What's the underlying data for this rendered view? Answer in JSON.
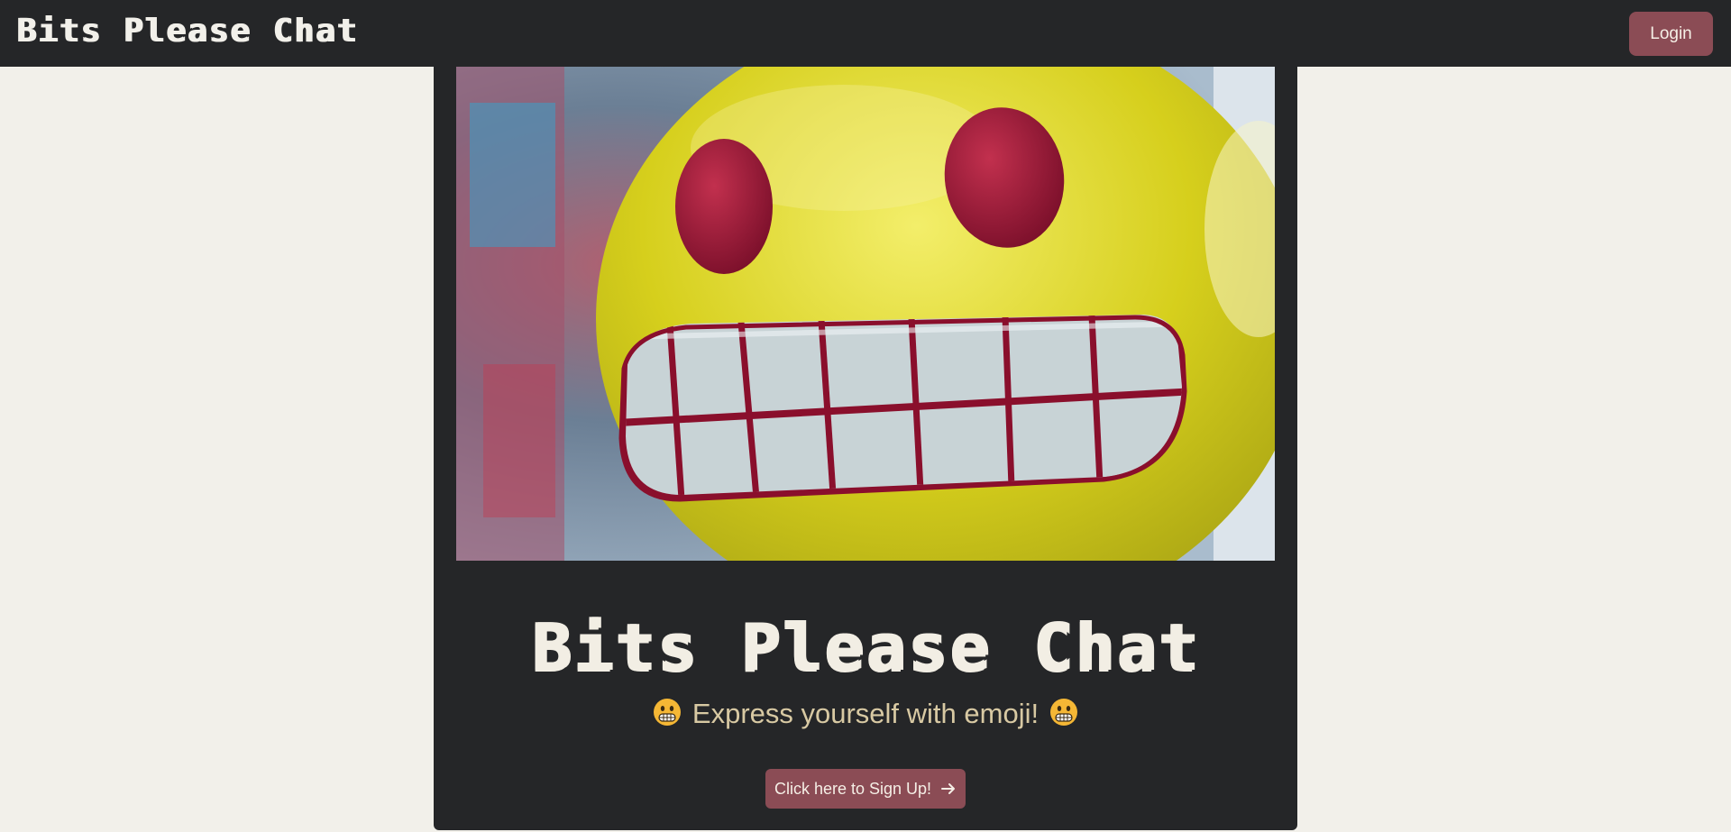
{
  "navbar": {
    "brand": "Bits Please Chat",
    "login_label": "Login"
  },
  "hero": {
    "title": "Bits Please Chat",
    "tagline": "Express yourself with emoji!",
    "tagline_icon": "grimacing-face-icon",
    "signup_label": "Click here to Sign Up!",
    "signup_icon": "arrow-right-icon"
  },
  "colors": {
    "navbar_bg": "#252628",
    "page_bg": "#f2f0ea",
    "accent": "#8b4c55",
    "tagline": "#d8c9a3",
    "title": "#f2eee4"
  }
}
